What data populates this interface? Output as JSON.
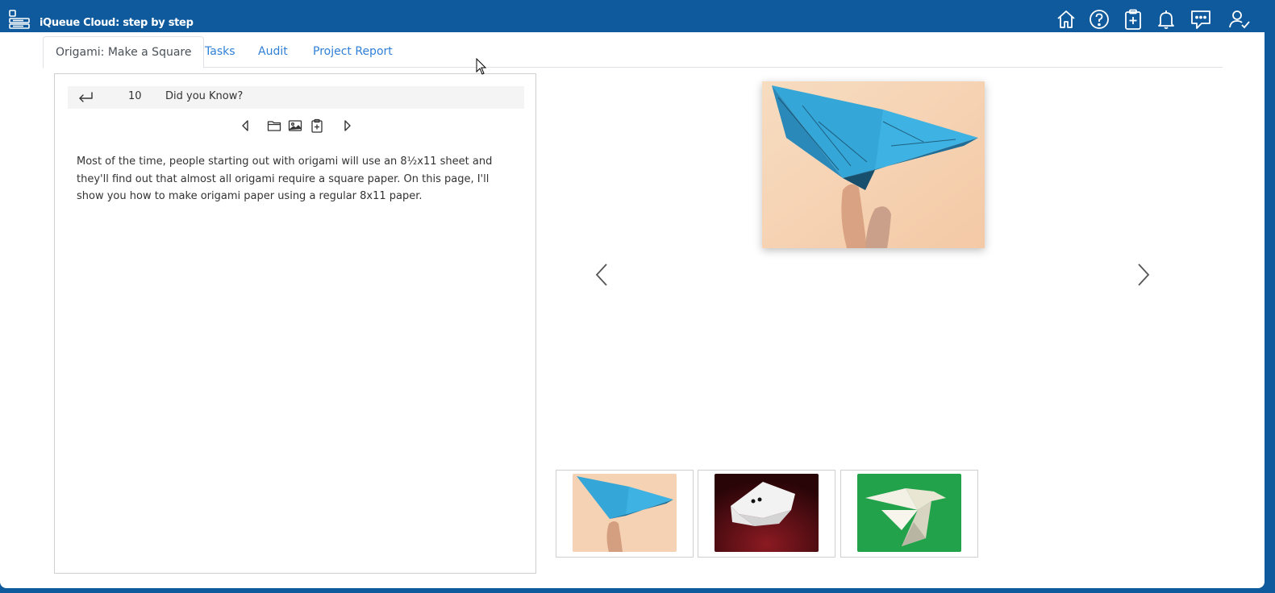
{
  "app": {
    "title": "iQueue Cloud: step by step",
    "brand_color": "#0f5a9c"
  },
  "header_icons": [
    "home-icon",
    "help-icon",
    "clipboard-add-icon",
    "bell-icon",
    "chat-icon",
    "user-check-icon"
  ],
  "tabs": [
    {
      "label": "Origami: Make a Square",
      "active": true
    },
    {
      "label": "Tasks",
      "active": false
    },
    {
      "label": "Audit",
      "active": false
    },
    {
      "label": "Project Report",
      "active": false
    }
  ],
  "step": {
    "number": "10",
    "title": "Did you Know?",
    "text": "Most of the time, people starting out with origami will use an 8½x11 sheet and they'll find out that almost all origami require a square paper. On this page, I'll show you how to make origami paper using a regular 8x11 paper."
  },
  "step_tools": [
    "previous-icon",
    "folder-icon",
    "image-icon",
    "clipboard-add-icon",
    "next-icon"
  ],
  "gallery": {
    "main": "origami-butterfly-image",
    "thumbnails": [
      "origami-butterfly-thumb",
      "origami-frog-thumb",
      "origami-dove-thumb"
    ]
  },
  "colors": {
    "link": "#2f7fd6",
    "butterfly_blue": "#3aa7d9",
    "frog_bg": "#4a0a0e",
    "dove_bg": "#22a24a"
  }
}
